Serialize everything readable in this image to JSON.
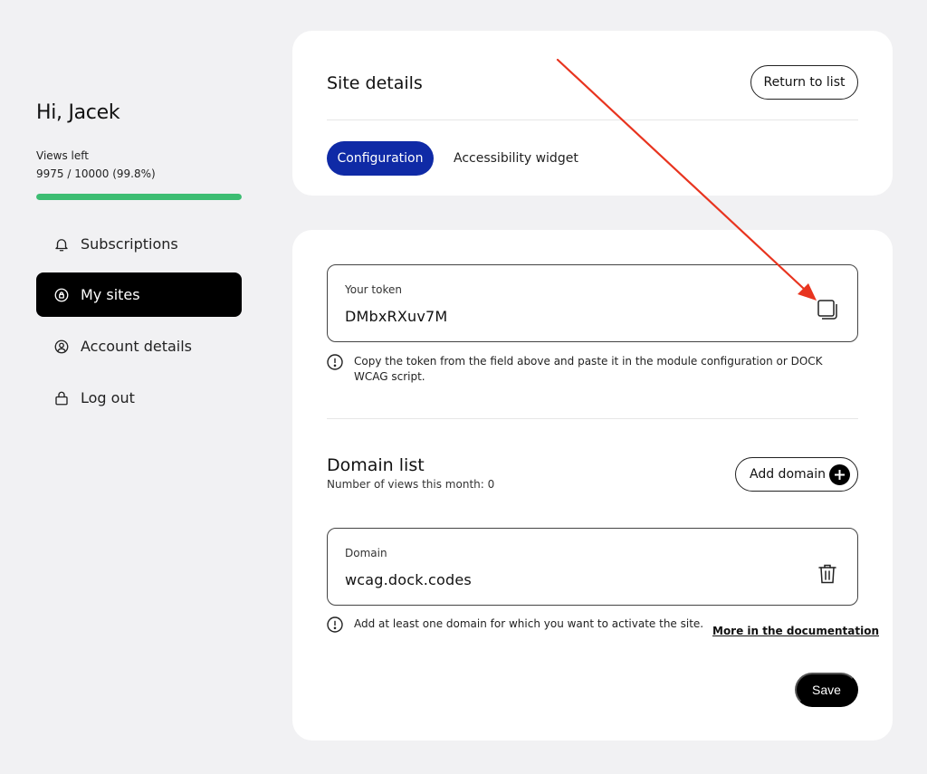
{
  "sidebar": {
    "greeting": "Hi, Jacek",
    "views_label": "Views left",
    "views_value": "9975 / 10000 (99.8%)",
    "views_progress": 0.998,
    "progress_color": "#3cbd72",
    "nav": [
      {
        "label": "Subscriptions",
        "icon": "bell-icon",
        "active": false
      },
      {
        "label": "My sites",
        "icon": "site-icon",
        "active": true
      },
      {
        "label": "Account details",
        "icon": "user-icon",
        "active": false
      },
      {
        "label": "Log out",
        "icon": "lock-icon",
        "active": false
      }
    ]
  },
  "site_details": {
    "title": "Site details",
    "return_label": "Return to list",
    "tabs": [
      {
        "label": "Configuration",
        "active": true
      },
      {
        "label": "Accessibility widget",
        "active": false
      }
    ],
    "accent_color": "#0f2aa6"
  },
  "token": {
    "label": "Your token",
    "value": "DMbxRXuv7M",
    "hint": "Copy the token from the field above and paste it in the module configuration or DOCK WCAG script."
  },
  "domains": {
    "title": "Domain list",
    "views_month": "Number of views this month: 0",
    "add_label": "Add domain",
    "field_label": "Domain",
    "field_value": "wcag.dock.codes",
    "hint": "Add at least one domain for which you want to activate the site.",
    "doc_link": "More in the documentation",
    "save_label": "Save"
  },
  "annotation": {
    "arrow_color": "#e8341f"
  }
}
